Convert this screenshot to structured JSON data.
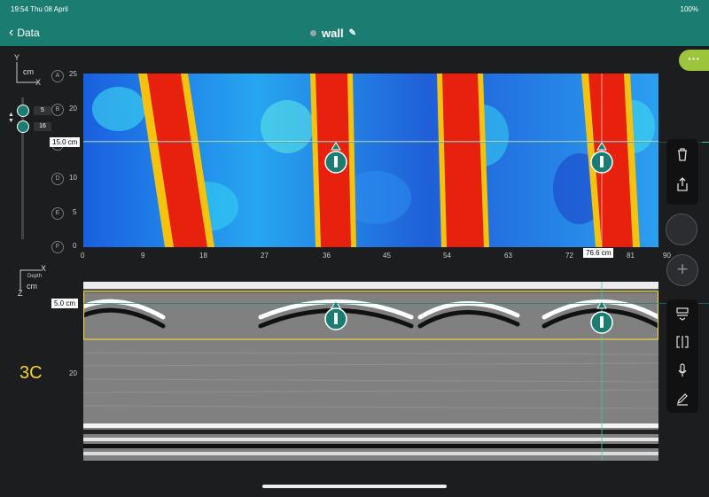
{
  "status": {
    "time": "19:54 Thu 08 April",
    "battery": "100%"
  },
  "nav": {
    "back_label": "Data",
    "title": "wall"
  },
  "more_label": "···",
  "top_view": {
    "axis_y": "Y",
    "axis_x": "X",
    "unit": "cm",
    "y_ticks": [
      "25",
      "20",
      "15",
      "10",
      "5",
      "0"
    ],
    "x_ticks": [
      "0",
      "9",
      "18",
      "27",
      "36",
      "45",
      "54",
      "63",
      "72",
      "81",
      "90"
    ],
    "row_buttons": [
      "A",
      "B",
      "C",
      "D",
      "E",
      "F"
    ],
    "slider_values": [
      "5",
      "16"
    ],
    "depth_badge": "15.0 cm",
    "position_badge": "76.6 cm"
  },
  "section_view": {
    "axis_x": "X",
    "axis_z": "Z",
    "depth_label": "Depth",
    "unit": "cm",
    "depth_badge": "5.0 cm",
    "z_tick": "20",
    "label": "3C"
  },
  "colors": {
    "teal": "#1b7d72",
    "lime": "#9cc43c",
    "label_yellow": "#f3d23a"
  }
}
